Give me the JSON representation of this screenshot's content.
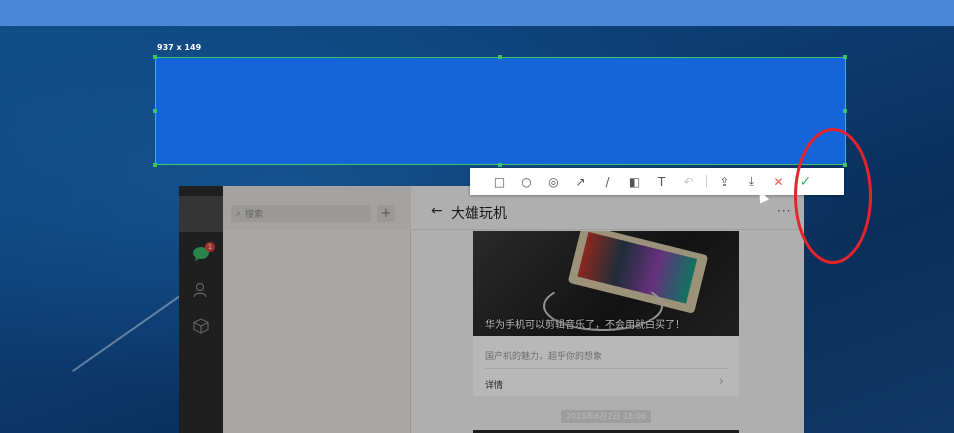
{
  "selection": {
    "size_label": "937 x 149"
  },
  "wechat": {
    "search_placeholder": "搜索",
    "add_button": "+",
    "unread_badge": "1",
    "chat": {
      "back": "←",
      "title": "大雄玩机",
      "more": "···"
    },
    "article": {
      "caption": "华为手机可以剪辑音乐了，不会用就白买了！",
      "description": "国产机的魅力，超乎你的想象",
      "detail_label": "详情",
      "chevron": "›"
    },
    "timestamp": "2018年6月2日 18:06"
  },
  "toolbar": {
    "tools": [
      {
        "icon": "rectangle-icon",
        "glyph": "□"
      },
      {
        "icon": "ellipse-icon",
        "glyph": "○"
      },
      {
        "icon": "mosaic-icon",
        "glyph": "◎"
      },
      {
        "icon": "arrow-icon",
        "glyph": "↗"
      },
      {
        "icon": "pen-icon",
        "glyph": "/"
      },
      {
        "icon": "highlight-icon",
        "glyph": "◧"
      },
      {
        "icon": "text-icon",
        "glyph": "T"
      },
      {
        "icon": "undo-icon",
        "glyph": "↶"
      }
    ],
    "actions": [
      {
        "icon": "share-icon",
        "glyph": "⇪"
      },
      {
        "icon": "download-icon",
        "glyph": "⤓"
      },
      {
        "icon": "cancel-icon",
        "glyph": "✕"
      },
      {
        "icon": "confirm-icon",
        "glyph": "✓"
      }
    ]
  },
  "colors": {
    "selection_fill": "#1565d8",
    "selection_border": "#3bc46a",
    "highlight_circle": "#e8232b",
    "confirm": "#3bb56a",
    "cancel": "#e25a5a"
  }
}
